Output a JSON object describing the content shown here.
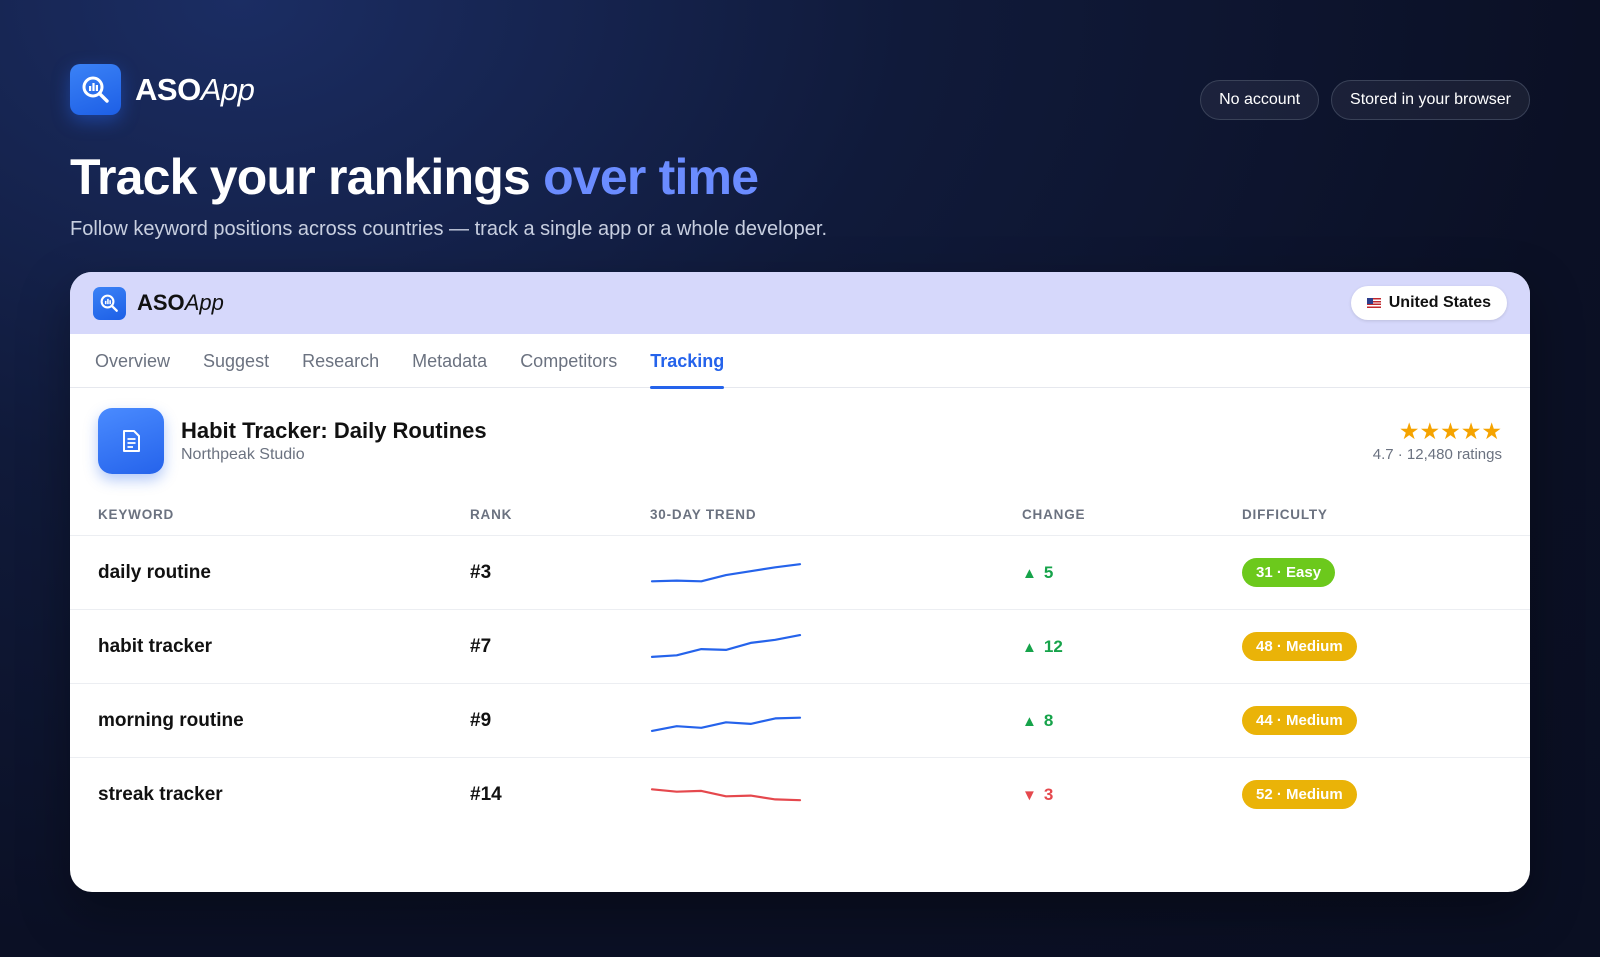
{
  "brand": {
    "name_bold": "ASO",
    "name_italic": "App",
    "icon": "magnifier-chart-icon"
  },
  "header_pills": [
    "No account",
    "Stored in your browser"
  ],
  "headline": {
    "main": "Track your rankings ",
    "accent": "over time",
    "accent_color": "#6b8cff"
  },
  "subhead": "Follow keyword positions across countries — track a single app or a whole developer.",
  "card": {
    "brand": {
      "name_bold": "ASO",
      "name_italic": "App"
    },
    "country": "United States",
    "tabs": [
      {
        "label": "Overview",
        "active": false
      },
      {
        "label": "Suggest",
        "active": false
      },
      {
        "label": "Research",
        "active": false
      },
      {
        "label": "Metadata",
        "active": false
      },
      {
        "label": "Competitors",
        "active": false
      },
      {
        "label": "Tracking",
        "active": true
      }
    ],
    "app": {
      "title": "Habit Tracker: Daily Routines",
      "developer": "Northpeak Studio",
      "stars": "★★★★★",
      "rating_text": "4.7 · 12,480 ratings",
      "icon": "document-icon"
    },
    "columns": {
      "keyword": "KEYWORD",
      "rank": "RANK",
      "trend": "30-DAY TREND",
      "change": "CHANGE",
      "difficulty": "DIFFICULTY"
    },
    "rows": [
      {
        "keyword": "daily routine",
        "rank": "#3",
        "trend": [
          7,
          7.5,
          7,
          11,
          13.5,
          16,
          18
        ],
        "trend_color": "#2563eb",
        "direction": "up",
        "arrow": "▲",
        "change": "5",
        "change_color": "#16a34a",
        "difficulty": "31 · Easy",
        "difficulty_color": "#6cc91c"
      },
      {
        "keyword": "habit tracker",
        "rank": "#7",
        "trend": [
          6,
          7,
          11,
          10.5,
          15,
          17,
          20
        ],
        "trend_color": "#2563eb",
        "direction": "up",
        "arrow": "▲",
        "change": "12",
        "change_color": "#16a34a",
        "difficulty": "48 · Medium",
        "difficulty_color": "#eab308"
      },
      {
        "keyword": "morning routine",
        "rank": "#9",
        "trend": [
          6,
          9,
          8,
          11.5,
          10.5,
          14,
          14.5
        ],
        "trend_color": "#2563eb",
        "direction": "up",
        "arrow": "▲",
        "change": "8",
        "change_color": "#16a34a",
        "difficulty": "44 · Medium",
        "difficulty_color": "#eab308"
      },
      {
        "keyword": "streak tracker",
        "rank": "#14",
        "trend": [
          16,
          14.5,
          15,
          11.5,
          12,
          9.5,
          9
        ],
        "trend_color": "#e5484d",
        "direction": "down",
        "arrow": "▼",
        "change": "3",
        "change_color": "#e5484d",
        "difficulty": "52 · Medium",
        "difficulty_color": "#eab308"
      }
    ]
  }
}
